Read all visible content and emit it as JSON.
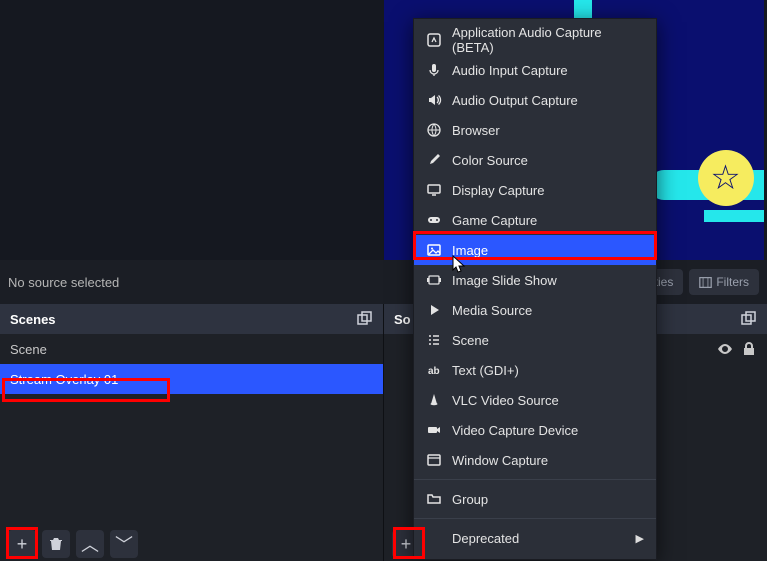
{
  "toolbar": {
    "no_source_text": "No source selected",
    "properties_label": "Properties",
    "filters_label": "Filters"
  },
  "panels": {
    "scenes": {
      "title": "Scenes"
    },
    "sources": {
      "title": "So"
    }
  },
  "scenes": {
    "items": [
      {
        "name": "Scene"
      },
      {
        "name": "Stream Overlay 01"
      }
    ],
    "selected_index": 1
  },
  "context_menu": {
    "items": [
      {
        "label": "Application Audio Capture (BETA)",
        "icon": "app-audio"
      },
      {
        "label": "Audio Input Capture",
        "icon": "mic"
      },
      {
        "label": "Audio Output Capture",
        "icon": "speaker"
      },
      {
        "label": "Browser",
        "icon": "globe"
      },
      {
        "label": "Color Source",
        "icon": "brush"
      },
      {
        "label": "Display Capture",
        "icon": "display"
      },
      {
        "label": "Game Capture",
        "icon": "gamepad"
      },
      {
        "label": "Image",
        "icon": "image"
      },
      {
        "label": "Image Slide Show",
        "icon": "slideshow"
      },
      {
        "label": "Media Source",
        "icon": "play"
      },
      {
        "label": "Scene",
        "icon": "list"
      },
      {
        "label": "Text (GDI+)",
        "icon": "text"
      },
      {
        "label": "VLC Video Source",
        "icon": "cone"
      },
      {
        "label": "Video Capture Device",
        "icon": "camera"
      },
      {
        "label": "Window Capture",
        "icon": "window"
      }
    ],
    "group_label": "Group",
    "deprecated_label": "Deprecated",
    "hover_index": 7
  }
}
